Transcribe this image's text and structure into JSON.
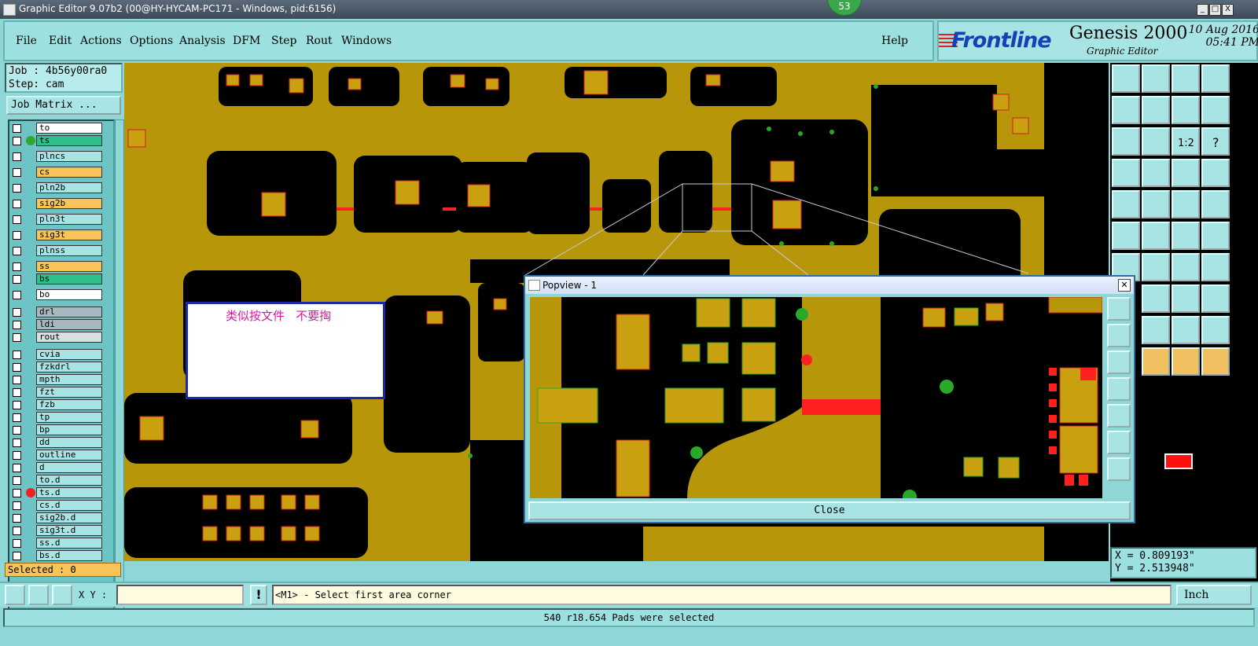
{
  "window": {
    "title": "Graphic Editor 9.07b2 (00@HY-HYCAM-PC171 - Windows, pid:6156)",
    "badge": "53",
    "controls": [
      "_",
      "□",
      "X"
    ]
  },
  "menu": {
    "items": [
      "File",
      "Edit",
      "Actions",
      "Options",
      "Analysis",
      "DFM",
      "Step",
      "Rout",
      "Windows"
    ],
    "help": "Help"
  },
  "brand": {
    "logo": "Frontline",
    "product": "Genesis 2000",
    "subtitle": "Graphic Editor",
    "date": "10 Aug 2016",
    "time": "05:41 PM"
  },
  "job": {
    "job_line": "Job : 4b56y00ra0",
    "step_line": "Step: cam",
    "matrix_button": "Job Matrix ..."
  },
  "layers": [
    {
      "name": "to",
      "color": "#ffffff",
      "marker": ""
    },
    {
      "name": "ts",
      "color": "#2fbf8f",
      "marker": "#2fa82f"
    },
    {
      "name": "plncs",
      "color": "#a9e4e4",
      "marker": ""
    },
    {
      "name": "cs",
      "color": "#f8c45a",
      "marker": ""
    },
    {
      "name": "pln2b",
      "color": "#a9e4e4",
      "marker": ""
    },
    {
      "name": "sig2b",
      "color": "#f8c45a",
      "marker": ""
    },
    {
      "name": "pln3t",
      "color": "#a9e4e4",
      "marker": ""
    },
    {
      "name": "sig3t",
      "color": "#f8c45a",
      "marker": ""
    },
    {
      "name": "plnss",
      "color": "#a9e4e4",
      "marker": ""
    },
    {
      "name": "ss",
      "color": "#f8c45a",
      "marker": ""
    },
    {
      "name": "bs",
      "color": "#2fbf8f",
      "marker": ""
    },
    {
      "name": "bo",
      "color": "#ffffff",
      "marker": ""
    },
    {
      "name": "drl",
      "color": "#a8b8c0",
      "marker": ""
    },
    {
      "name": "ldi",
      "color": "#a8b8c0",
      "marker": ""
    },
    {
      "name": "rout",
      "color": "#d8e0e0",
      "marker": ""
    },
    {
      "name": "cvia",
      "color": "#a9e4e4",
      "marker": ""
    },
    {
      "name": "fzkdrl",
      "color": "#a9e4e4",
      "marker": ""
    },
    {
      "name": "mpth",
      "color": "#a9e4e4",
      "marker": ""
    },
    {
      "name": "fzt",
      "color": "#a9e4e4",
      "marker": ""
    },
    {
      "name": "fzb",
      "color": "#a9e4e4",
      "marker": ""
    },
    {
      "name": "tp",
      "color": "#a9e4e4",
      "marker": ""
    },
    {
      "name": "bp",
      "color": "#a9e4e4",
      "marker": ""
    },
    {
      "name": "dd",
      "color": "#a9e4e4",
      "marker": ""
    },
    {
      "name": "outline",
      "color": "#a9e4e4",
      "marker": ""
    },
    {
      "name": "d",
      "color": "#a9e4e4",
      "marker": ""
    },
    {
      "name": "to.d",
      "color": "#a9e4e4",
      "marker": ""
    },
    {
      "name": "ts.d",
      "color": "#a9e4e4",
      "marker": "#ee2020"
    },
    {
      "name": "cs.d",
      "color": "#a9e4e4",
      "marker": ""
    },
    {
      "name": "sig2b.d",
      "color": "#a9e4e4",
      "marker": ""
    },
    {
      "name": "sig3t.d",
      "color": "#a9e4e4",
      "marker": ""
    },
    {
      "name": "ss.d",
      "color": "#a9e4e4",
      "marker": ""
    },
    {
      "name": "bs.d",
      "color": "#a9e4e4",
      "marker": ""
    }
  ],
  "selected_count": "Selected : 0",
  "note": "类似按文件   不要掏",
  "popview": {
    "title": "Popview - 1",
    "close_label": "Close"
  },
  "coords": {
    "x": "X = 0.809193\"",
    "y": "Y = 2.513948\""
  },
  "bottom": {
    "xy_label": "X Y :",
    "xy_value": "",
    "excl": "!",
    "prompt": "<M1> - Select first area corner",
    "unit": "Inch"
  },
  "status": "540 r18.654 Pads were selected",
  "colors": {
    "copper": "#b8960a",
    "pad": "#c8a010",
    "background": "#000000",
    "highlight": "#ff2020",
    "via": "#2aa82a"
  }
}
